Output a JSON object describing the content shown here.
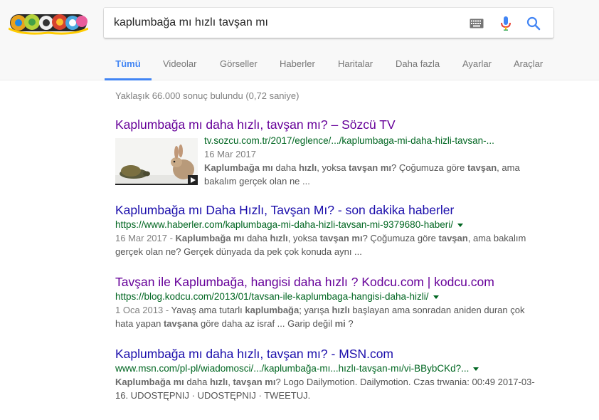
{
  "search": {
    "query": "kaplumbağa mı hızlı tavşan mı"
  },
  "tabs": [
    {
      "label": "Tümü"
    },
    {
      "label": "Videolar"
    },
    {
      "label": "Görseller"
    },
    {
      "label": "Haberler"
    },
    {
      "label": "Haritalar"
    },
    {
      "label": "Daha fazla"
    },
    {
      "label": "Ayarlar"
    },
    {
      "label": "Araçlar"
    }
  ],
  "stats": "Yaklaşık 66.000 sonuç bulundu (0,72 saniye)",
  "colors": {
    "link_visited": "#660099",
    "link": "#1a0dab",
    "url": "#006621",
    "accent": "#4285f4"
  },
  "results": [
    {
      "title": "Kaplumbağa mı daha hızlı, tavşan mı? – Sözcü TV",
      "url": "tv.sozcu.com.tr/2017/eglence/.../kaplumbaga-mi-daha-hizli-tavsan-...",
      "date": "16 Mar 2017",
      "snippet_parts": [
        "Kaplumbağa mı",
        " daha ",
        "hızlı",
        ", yoksa ",
        "tavşan mı",
        "? Çoğumuza göre ",
        "tavşan",
        ", ama bakalım gerçek olan ne ..."
      ]
    },
    {
      "title": "Kaplumbağa mı Daha Hızlı, Tavşan Mı? - son dakika haberler",
      "url": "https://www.haberler.com/kaplumbaga-mi-daha-hizli-tavsan-mi-9379680-haberi/",
      "date": "16 Mar 2017 - ",
      "snippet_parts": [
        "Kaplumbağa mı",
        " daha ",
        "hızlı",
        ", yoksa ",
        "tavşan mı",
        "? Çoğumuza göre ",
        "tavşan",
        ", ama bakalım gerçek olan ne? Gerçek dünyada da pek çok konuda aynı ..."
      ]
    },
    {
      "title": "Tavşan ile Kaplumbağa, hangisi daha hızlı ? Kodcu.com | kodcu.com",
      "url": "https://blog.kodcu.com/2013/01/tavsan-ile-kaplumbaga-hangisi-daha-hizli/",
      "date": "1 Oca 2013 - ",
      "snippet_parts": [
        "Yavaş ama tutarlı ",
        "kaplumbağa",
        "; yarışa ",
        "hızlı",
        " başlayan ama sonradan aniden duran çok hata yapan ",
        "tavşana",
        " göre daha az israf ... Garip değil ",
        "mi",
        " ?"
      ]
    },
    {
      "title": "Kaplumbağa mı daha hızlı, tavşan mı? - MSN.com",
      "url": "www.msn.com/pl-pl/wiadomosci/.../kaplumbağa-mı...hızlı-tavşan-mı/vi-BBybCKd?...",
      "snippet_parts": [
        "Kaplumbağa mı",
        " daha ",
        "hızlı",
        ", ",
        "tavşan mı",
        "? Logo Dailymotion. Dailymotion. Czas trwania: 00:49 2017-03-16. UDOSTĘPNIJ · UDOSTĘPNIJ · TWEETUJ."
      ]
    }
  ]
}
